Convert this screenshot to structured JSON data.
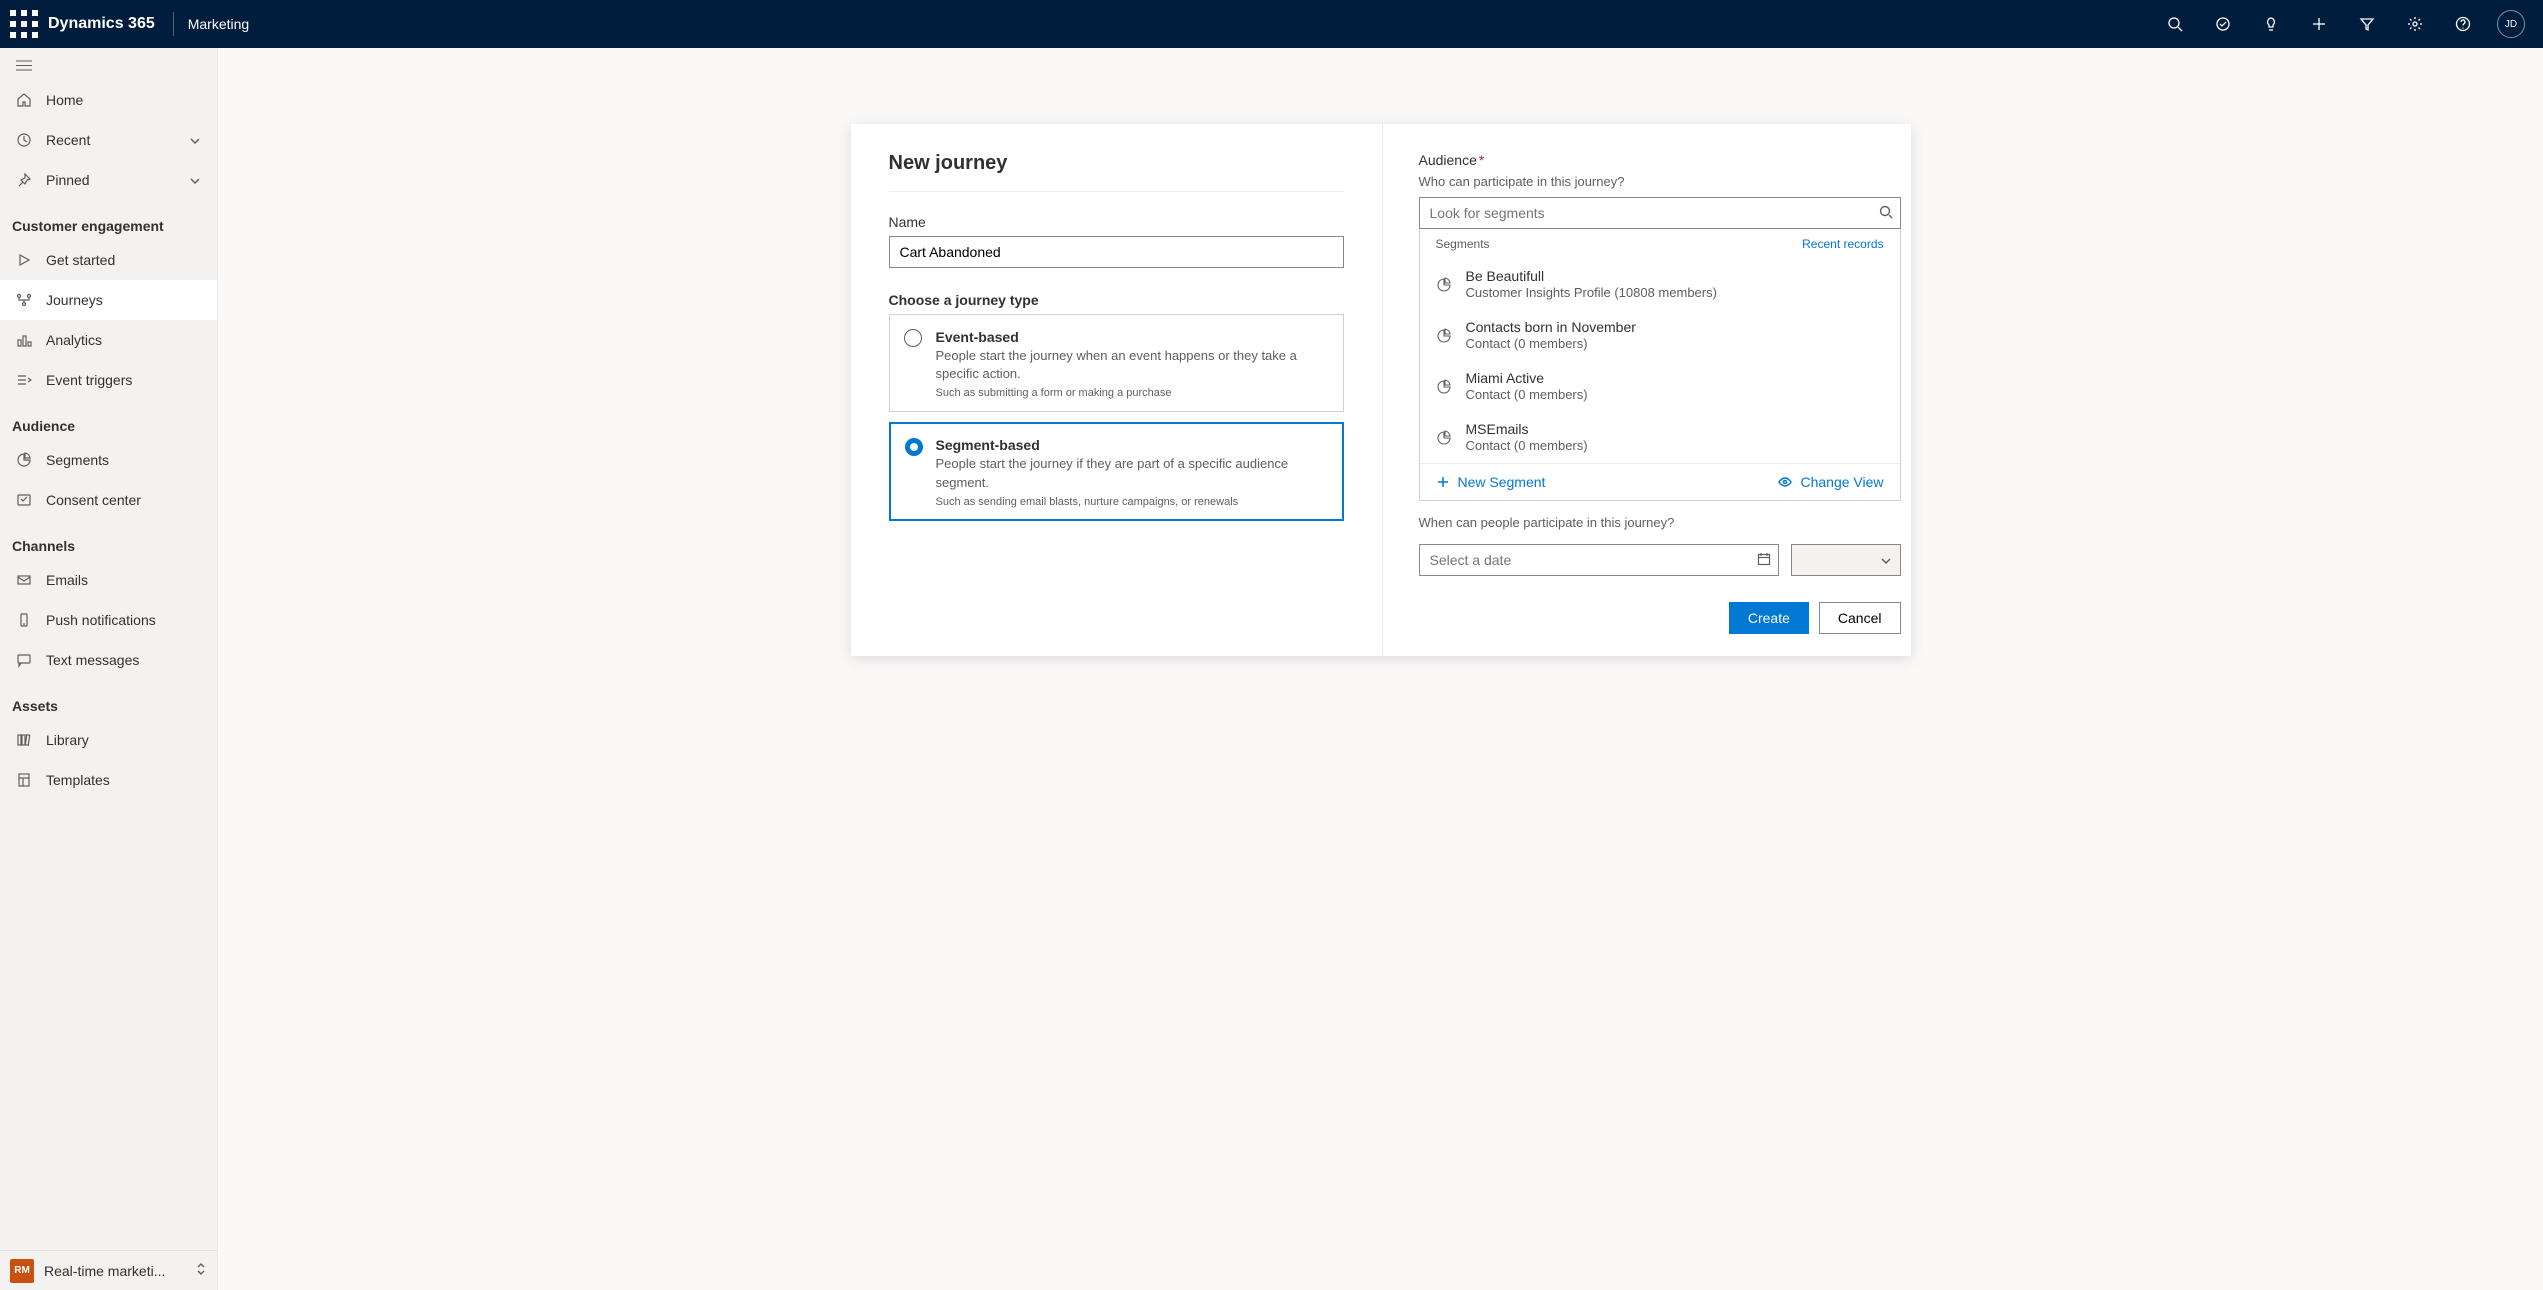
{
  "topbar": {
    "brand": "Dynamics 365",
    "sub": "Marketing",
    "avatar": "JD"
  },
  "sidebar": {
    "home": "Home",
    "recent": "Recent",
    "pinned": "Pinned",
    "group_engagement": "Customer engagement",
    "get_started": "Get started",
    "journeys": "Journeys",
    "analytics": "Analytics",
    "event_triggers": "Event triggers",
    "group_audience": "Audience",
    "segments": "Segments",
    "consent_center": "Consent center",
    "group_channels": "Channels",
    "emails": "Emails",
    "push": "Push notifications",
    "text": "Text messages",
    "group_assets": "Assets",
    "library": "Library",
    "templates": "Templates",
    "area_badge": "RM",
    "area_label": "Real-time marketi..."
  },
  "dialog": {
    "title": "New journey",
    "name_label": "Name",
    "name_value": "Cart Abandoned",
    "choose_type": "Choose a journey type",
    "event_based": {
      "title": "Event-based",
      "desc": "People start the journey when an event happens or they take a specific action.",
      "example": "Such as submitting a form or making a purchase"
    },
    "segment_based": {
      "title": "Segment-based",
      "desc": "People start the journey if they are part of a specific audience segment.",
      "example": "Such as sending email blasts, nurture campaigns, or renewals"
    },
    "audience_label": "Audience",
    "audience_sub": "Who can participate in this journey?",
    "lookup_placeholder": "Look for segments",
    "segments_header": "Segments",
    "recent_records": "Recent records",
    "segments": [
      {
        "name": "Be Beautifull",
        "meta": "Customer Insights Profile (10808 members)"
      },
      {
        "name": "Contacts born in November",
        "meta": "Contact (0 members)"
      },
      {
        "name": "Miami Active",
        "meta": "Contact (0 members)"
      },
      {
        "name": "MSEmails",
        "meta": "Contact (0 members)"
      }
    ],
    "new_segment": "New Segment",
    "change_view": "Change View",
    "when_label": "When can people participate in this journey?",
    "date_placeholder": "Select a date",
    "create": "Create",
    "cancel": "Cancel"
  }
}
